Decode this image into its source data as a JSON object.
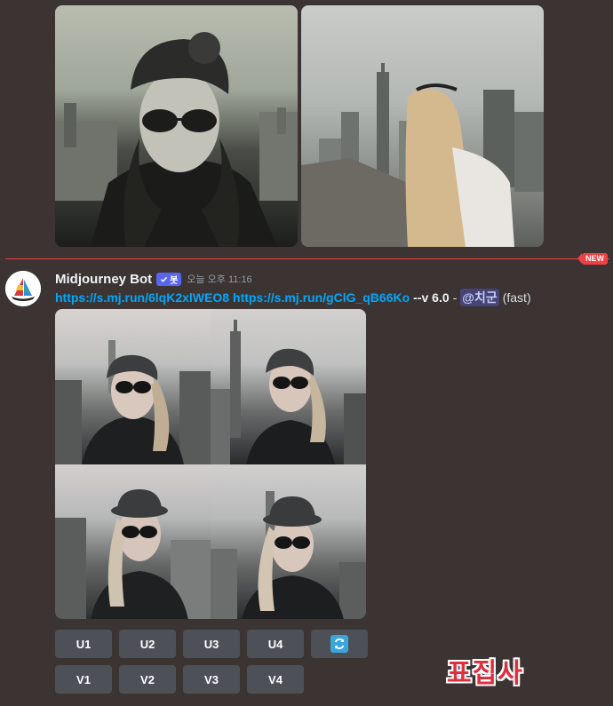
{
  "new_badge": "NEW",
  "message": {
    "author": "Midjourney Bot",
    "bot_tag": "봇",
    "timestamp": "오늘 오후 11:16",
    "link1": "https://s.mj.run/6lqK2xlWEO8",
    "link2": "https://s.mj.run/gClG_qB66Ko",
    "params": "--v 6.0",
    "dash": "-",
    "mention": "@치군",
    "speed": "(fast)"
  },
  "buttons": {
    "upscale": [
      "U1",
      "U2",
      "U3",
      "U4"
    ],
    "variation": [
      "V1",
      "V2",
      "V3",
      "V4"
    ]
  },
  "watermark": "표집사",
  "colors": {
    "background": "#3b3433",
    "link": "#00a8fc",
    "button": "#4e5058",
    "new_divider": "#f23f43",
    "bot_tag": "#5865f2",
    "reroll_icon": "#3ba6dc"
  }
}
